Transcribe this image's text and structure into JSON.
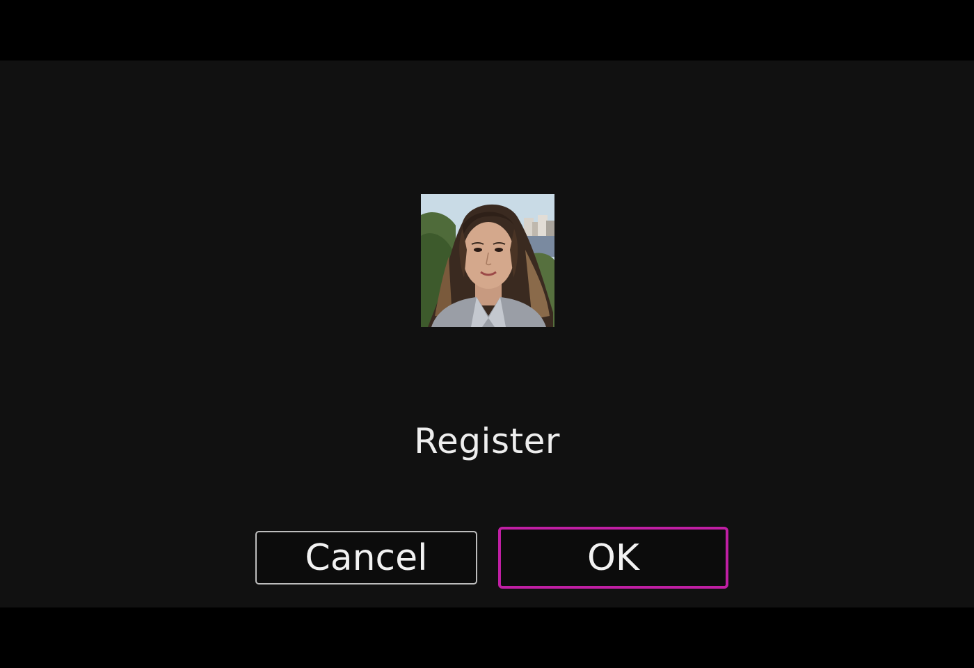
{
  "dialog": {
    "title": "Register",
    "thumbnail_icon": "face-portrait-thumbnail",
    "cancel_label": "Cancel",
    "ok_label": "OK"
  },
  "colors": {
    "background": "#111111",
    "letterbox": "#000000",
    "focus_border": "#c01fa4",
    "button_border": "#bdbdbd",
    "text": "#eeeeee"
  }
}
